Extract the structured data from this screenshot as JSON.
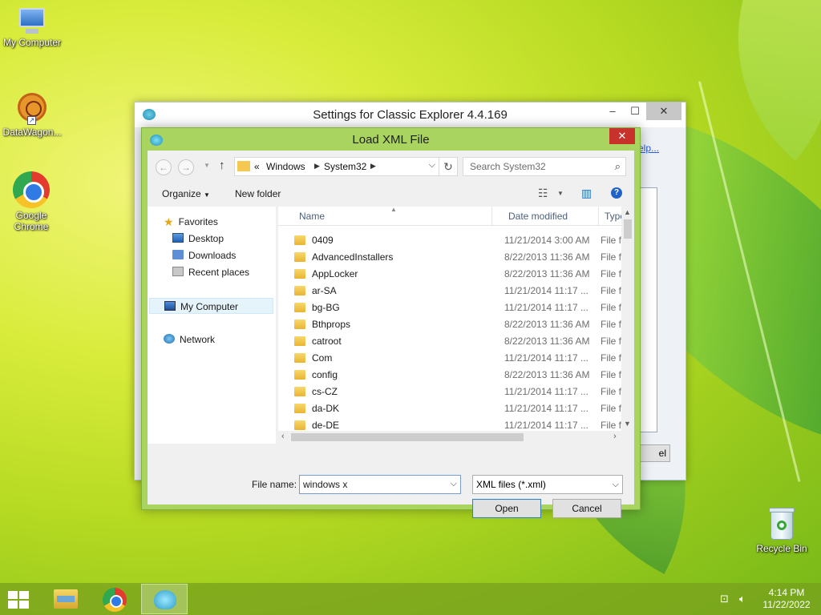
{
  "desktop": {
    "icons": [
      {
        "label": "My Computer"
      },
      {
        "label": "DataWagon..."
      },
      {
        "label": "Google Chrome"
      },
      {
        "label": "Recycle Bin"
      }
    ]
  },
  "bg_window": {
    "title": "Settings for Classic Explorer 4.4.169",
    "minimize": "–",
    "maximize": "☐",
    "close": "✕",
    "help_link": "elp...",
    "partial_button": "el"
  },
  "dialog": {
    "title": "Load XML File",
    "close": "✕",
    "address": {
      "prefix": "«",
      "crumbs": [
        "Windows",
        "System32"
      ]
    },
    "search_placeholder": "Search System32",
    "toolbar": {
      "organize": "Organize",
      "new_folder": "New folder"
    },
    "nav_pane": {
      "favorites": "Favorites",
      "desktop": "Desktop",
      "downloads": "Downloads",
      "recent": "Recent places",
      "computer": "My Computer",
      "network": "Network"
    },
    "columns": {
      "name": "Name",
      "date": "Date modified",
      "type": "Type"
    },
    "files": [
      {
        "name": "0409",
        "date": "11/21/2014 3:00 AM",
        "type": "File fol"
      },
      {
        "name": "AdvancedInstallers",
        "date": "8/22/2013 11:36 AM",
        "type": "File fol"
      },
      {
        "name": "AppLocker",
        "date": "8/22/2013 11:36 AM",
        "type": "File fol"
      },
      {
        "name": "ar-SA",
        "date": "11/21/2014 11:17 ...",
        "type": "File fol"
      },
      {
        "name": "bg-BG",
        "date": "11/21/2014 11:17 ...",
        "type": "File fol"
      },
      {
        "name": "Bthprops",
        "date": "8/22/2013 11:36 AM",
        "type": "File fol"
      },
      {
        "name": "catroot",
        "date": "8/22/2013 11:36 AM",
        "type": "File fol"
      },
      {
        "name": "Com",
        "date": "11/21/2014 11:17 ...",
        "type": "File fol"
      },
      {
        "name": "config",
        "date": "8/22/2013 11:36 AM",
        "type": "File fol"
      },
      {
        "name": "cs-CZ",
        "date": "11/21/2014 11:17 ...",
        "type": "File fol"
      },
      {
        "name": "da-DK",
        "date": "11/21/2014 11:17 ...",
        "type": "File fol"
      },
      {
        "name": "de-DE",
        "date": "11/21/2014 11:17 ...",
        "type": "File fol"
      }
    ],
    "file_name_label": "File name:",
    "file_name_value": "windows x",
    "file_type": "XML files (*.xml)",
    "open_button": "Open",
    "cancel_button": "Cancel"
  },
  "taskbar": {
    "time": "4:14 PM",
    "date": "11/22/2022"
  }
}
